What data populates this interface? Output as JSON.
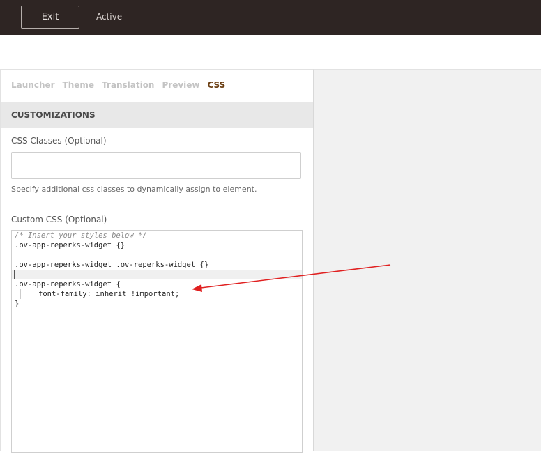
{
  "topbar": {
    "exit_label": "Exit",
    "status": "Active"
  },
  "tabs": [
    {
      "label": "Launcher",
      "active": false
    },
    {
      "label": "Theme",
      "active": false
    },
    {
      "label": "Translation",
      "active": false
    },
    {
      "label": "Preview",
      "active": false
    },
    {
      "label": "CSS",
      "active": true
    }
  ],
  "section": {
    "title": "CUSTOMIZATIONS"
  },
  "css_classes": {
    "label": "CSS Classes (Optional)",
    "value": "",
    "help": "Specify additional css classes to dynamically assign to element."
  },
  "custom_css": {
    "label": "Custom CSS (Optional)",
    "lines": [
      "/* Insert your styles below */",
      ".ov-app-reperks-widget {}",
      "",
      ".ov-app-reperks-widget .ov-reperks-widget {}",
      "",
      ".ov-app-reperks-widget {",
      "font-family: inherit !important;",
      "}"
    ]
  },
  "colors": {
    "topbar": "#2e2523",
    "active_tab": "#6b3e12",
    "annotation_arrow": "#e02020"
  }
}
